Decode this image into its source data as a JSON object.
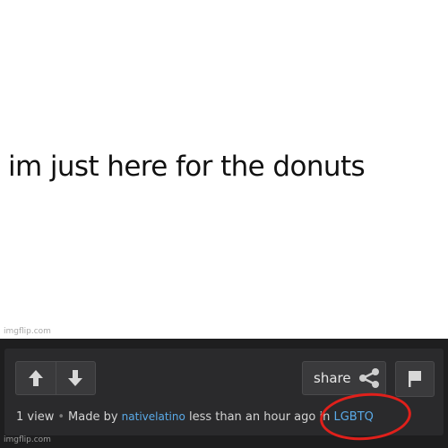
{
  "meme": {
    "caption": "im just here for the donuts",
    "watermark": "imgflip.com"
  },
  "actions": {
    "upvote_icon": "arrow-up-icon",
    "downvote_icon": "arrow-down-icon",
    "share_label": "share",
    "share_icon": "share-icon",
    "flag_icon": "flag-icon"
  },
  "meta": {
    "views": "1 view",
    "made_by_prefix": "Made by",
    "username": "nativelatino",
    "time_text": "less than an hour ago in",
    "stream": "LGBTQ"
  },
  "footer": {
    "watermark": "imgflip.com"
  },
  "colors": {
    "panel_bg": "#1e1e1f",
    "card_bg": "#2a2a2c",
    "link": "#5aaae8",
    "annotation": "#e0201b"
  }
}
